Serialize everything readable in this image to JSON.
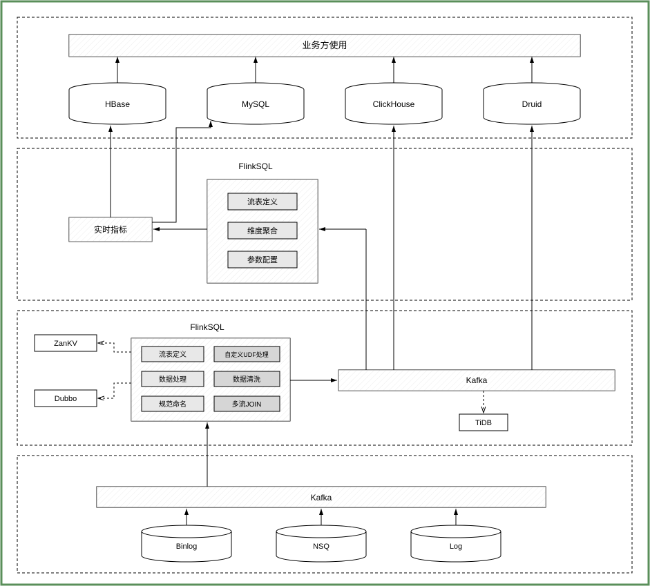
{
  "top": {
    "consumer_bar": "业务方使用",
    "sinks": [
      "HBase",
      "MySQL",
      "ClickHouse",
      "Druid"
    ]
  },
  "layer2": {
    "title": "FlinkSQL",
    "realtime": "实时指标",
    "items": [
      "流表定义",
      "维度聚合",
      "参数配置"
    ]
  },
  "layer3": {
    "title": "FlinkSQL",
    "left_services": [
      "ZanKV",
      "Dubbo"
    ],
    "left_col": [
      "流表定义",
      "数据处理",
      "规范命名"
    ],
    "right_col": [
      "自定义UDF处理",
      "数据清洗",
      "多流JOIN"
    ],
    "kafka": "Kafka",
    "tidb": "TiDB"
  },
  "bottom": {
    "kafka": "Kafka",
    "sources": [
      "Binlog",
      "NSQ",
      "Log"
    ]
  }
}
